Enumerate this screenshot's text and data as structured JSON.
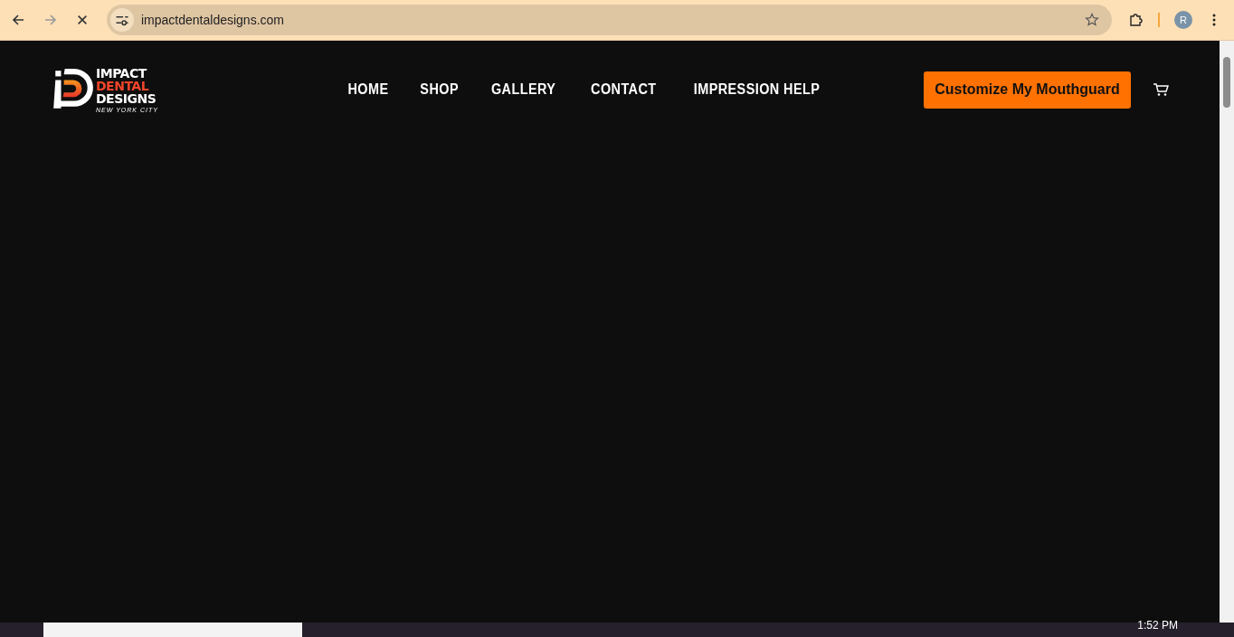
{
  "browser": {
    "url": "impactdentaldesigns.com",
    "profile_initial": "R",
    "loading": true
  },
  "logo": {
    "lines": [
      "IMPACT",
      "DENTAL",
      "DESIGNS"
    ],
    "tagline": "NEW YORK CITY"
  },
  "nav": [
    "HOME",
    "SHOP",
    "GALLERY",
    "CONTACT",
    "IMPRESSION HELP"
  ],
  "cta": "Customize My Mouthguard",
  "taskbar": {
    "time": "1:52 PM"
  }
}
